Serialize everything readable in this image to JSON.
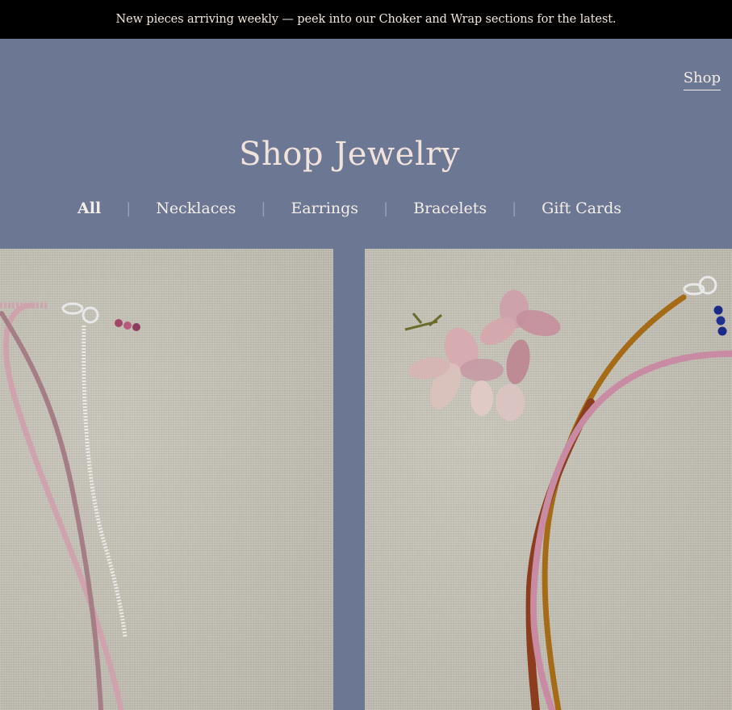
{
  "announcement": {
    "text": "New pieces arriving weekly — peek into our Choker and Wrap sections for the latest."
  },
  "nav": {
    "shop_label": "Shop"
  },
  "page": {
    "title": "Shop Jewelry"
  },
  "filters": [
    {
      "label": "All",
      "active": true
    },
    {
      "label": "Necklaces",
      "active": false
    },
    {
      "label": "Earrings",
      "active": false
    },
    {
      "label": "Bracelets",
      "active": false
    },
    {
      "label": "Gift Cards",
      "active": false
    }
  ],
  "separator": "|",
  "products": [
    {
      "image": "pink-beaded-necklace-photo"
    },
    {
      "image": "amber-and-pink-beaded-necklace-with-dried-flowers-photo"
    }
  ],
  "colors": {
    "header_bg": "#6c7794",
    "announcement_bg": "#000000",
    "title_text": "#f1e3dc"
  }
}
